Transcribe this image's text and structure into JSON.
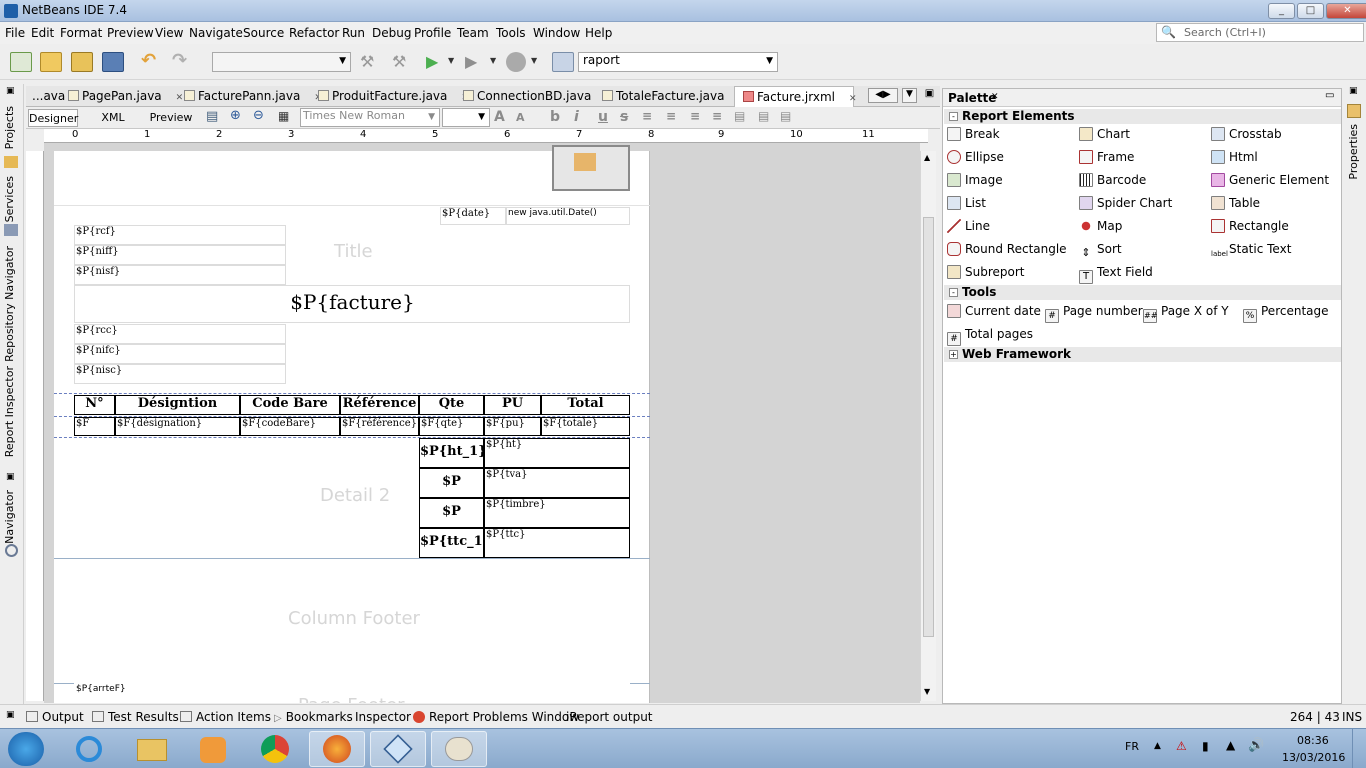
{
  "window": {
    "title": "NetBeans IDE 7.4",
    "min": "_",
    "max": "□",
    "close": "✕"
  },
  "menu": [
    "File",
    "Edit",
    "Format",
    "Preview",
    "View",
    "Navigate",
    "Source",
    "Refactor",
    "Run",
    "Debug",
    "Profile",
    "Team",
    "Tools",
    "Window",
    "Help"
  ],
  "search": {
    "placeholder": "Search (Ctrl+I)"
  },
  "toolbar": {
    "config_combo": "",
    "report_combo": "raport"
  },
  "left_panels": [
    "Projects",
    "Services",
    "Repository Navigator",
    "Report Inspector",
    "Navigator"
  ],
  "right_panels": [
    "Properties"
  ],
  "editor_tabs": [
    {
      "label": "...ava",
      "close": "✕"
    },
    {
      "label": "PagePan.java",
      "close": "✕"
    },
    {
      "label": "FacturePann.java",
      "close": "✕"
    },
    {
      "label": "ProduitFacture.java",
      "close": "✕"
    },
    {
      "label": "ConnectionBD.java",
      "close": "✕"
    },
    {
      "label": "TotaleFacture.java",
      "close": "✕"
    },
    {
      "label": "Facture.jrxml",
      "close": "✕"
    }
  ],
  "designer": {
    "tabs": [
      "Designer",
      "XML",
      "Preview"
    ],
    "font_combo": "Times New Roman",
    "size_combo": ""
  },
  "ruler": [
    "0",
    "1",
    "2",
    "3",
    "4",
    "5",
    "6",
    "7",
    "8",
    "9",
    "10",
    "11"
  ],
  "report": {
    "bands": {
      "title": "Title",
      "detail2": "Detail 2",
      "column_footer": "Column Footer",
      "page_footer": "Page Footer"
    },
    "fields": {
      "date": "$P{date}",
      "date_expr": "new java.util.Date()",
      "rcf": "$P{rcf}",
      "niff": "$P{niff}",
      "nisf": "$P{nisf}",
      "facture": "$P{facture}",
      "rcc": "$P{rcc}",
      "nifc": "$P{nifc}",
      "nisc": "$P{nisc}",
      "arrete": "$P{arrteF}"
    },
    "table_headers": [
      "N°",
      "Désigntion",
      "Code Bare",
      "Référence",
      "Qte",
      "PU",
      "Total"
    ],
    "table_row": [
      "$F",
      "$F{désignation}",
      "$F{codeBare}",
      "$F{référence}",
      "$F{qte}",
      "$F{pu}",
      "$F{totale}"
    ],
    "totals": [
      {
        "label": "$P{ht_1}",
        "value": "$P{ht}"
      },
      {
        "label": "$P",
        "value": "$P{tva}"
      },
      {
        "label": "$P",
        "value": "$P{timbre}"
      },
      {
        "label": "$P{ttc_1}",
        "value": "$P{ttc}"
      }
    ]
  },
  "palette": {
    "title": "Palette",
    "close": "✕",
    "min": "▭",
    "report_elements": {
      "title": "Report Elements",
      "items": [
        "Break",
        "Chart",
        "Crosstab",
        "Ellipse",
        "Frame",
        "Html",
        "Image",
        "Barcode",
        "Generic Element",
        "List",
        "Spider Chart",
        "Table",
        "Line",
        "Map",
        "Rectangle",
        "Round Rectangle",
        "Sort",
        "Static Text",
        "Subreport",
        "Text Field"
      ]
    },
    "tools": {
      "title": "Tools",
      "items": [
        "Current date",
        "Page number",
        "Page X of Y",
        "Percentage",
        "Total pages"
      ]
    },
    "web": {
      "title": "Web Framework"
    }
  },
  "statusbar": {
    "items": [
      "Output",
      "Test Results",
      "Action Items",
      "Bookmarks",
      "Inspector",
      "Report Problems Window",
      "iReport output"
    ],
    "position": "264 | 43",
    "mode": "INS"
  },
  "taskbar": {
    "lang": "FR",
    "time": "08:36",
    "date": "13/03/2016"
  }
}
